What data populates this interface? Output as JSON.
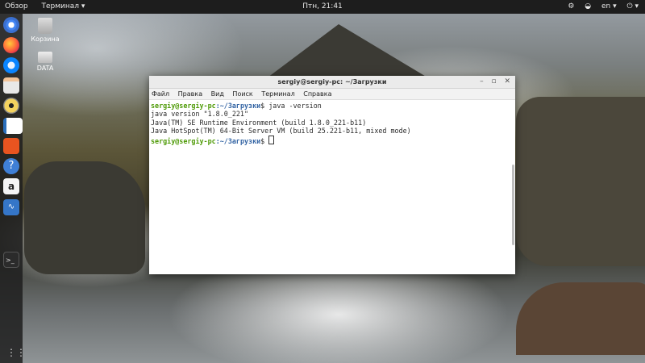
{
  "topbar": {
    "activities": "Обзор",
    "app_menu": "Терминал ▾",
    "clock": "Птн, 21:41",
    "lang": "en ▾"
  },
  "desktop": {
    "icons": [
      {
        "label": "Корзина"
      },
      {
        "label": "DATA"
      }
    ]
  },
  "terminal": {
    "title": "sergiy@sergiy-pc: ~/Загрузки",
    "menu": [
      "Файл",
      "Правка",
      "Вид",
      "Поиск",
      "Терминал",
      "Справка"
    ],
    "prompt_user": "sergiy@sergiy-pc",
    "prompt_path": ":~/Загрузки",
    "prompt_symbol": "$",
    "command": " java -version",
    "output": [
      "java version \"1.8.0_221\"",
      "Java(TM) SE Runtime Environment (build 1.8.0_221-b11)",
      "Java HotSpot(TM) 64-Bit Server VM (build 25.221-b11, mixed mode)"
    ]
  }
}
